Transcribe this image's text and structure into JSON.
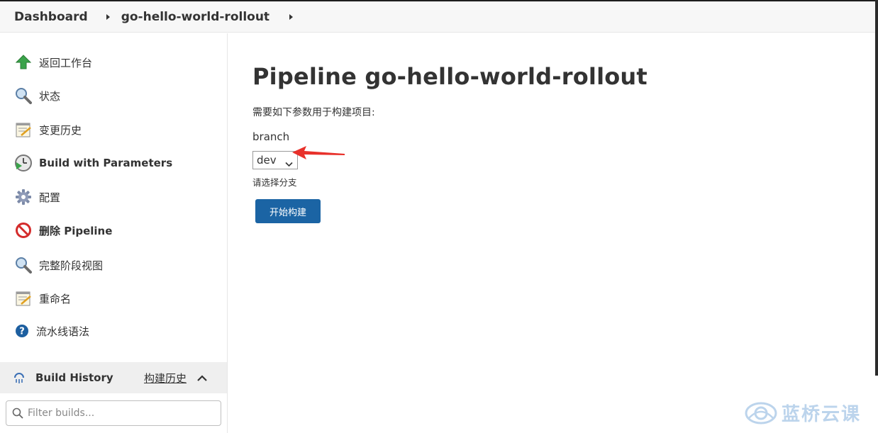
{
  "breadcrumb": {
    "items": [
      "Dashboard",
      "go-hello-world-rollout"
    ]
  },
  "sidebar": {
    "items": [
      {
        "label": "返回工作台",
        "icon": "up-arrow-icon"
      },
      {
        "label": "状态",
        "icon": "magnifier-icon"
      },
      {
        "label": "变更历史",
        "icon": "notepad-icon"
      },
      {
        "label": "Build with Parameters",
        "icon": "clock-play-icon"
      },
      {
        "label": "配置",
        "icon": "gear-icon"
      },
      {
        "label": "删除 Pipeline",
        "icon": "no-entry-icon"
      },
      {
        "label": "完整阶段视图",
        "icon": "magnifier-icon"
      },
      {
        "label": "重命名",
        "icon": "notepad-icon"
      },
      {
        "label": "流水线语法",
        "icon": "help-icon"
      }
    ],
    "build_history": {
      "title": "Build History",
      "link": "构建历史"
    },
    "filter": {
      "placeholder": "Filter builds..."
    }
  },
  "main": {
    "title": "Pipeline go-hello-world-rollout",
    "intro": "需要如下参数用于构建项目:",
    "parameter": {
      "name": "branch",
      "selected": "dev",
      "description": "请选择分支"
    },
    "build_button": "开始构建"
  },
  "watermark": "蓝桥云课",
  "colors": {
    "accent": "#1b64a4",
    "annotation": "#e8302a",
    "sidebar_header_bg": "#efefef"
  }
}
